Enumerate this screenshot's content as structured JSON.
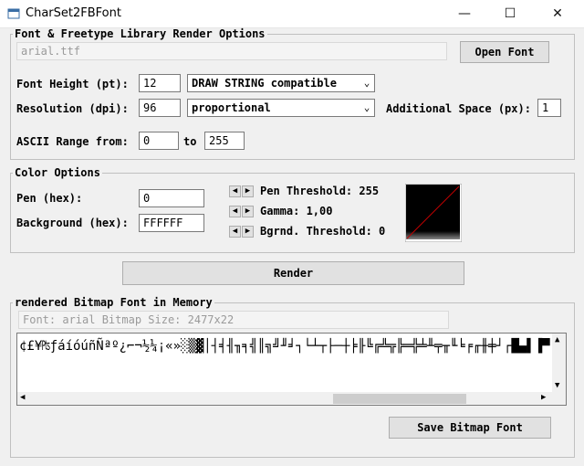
{
  "window": {
    "title": "CharSet2FBFont",
    "minimize_glyph": "—",
    "maximize_glyph": "☐",
    "close_glyph": "✕"
  },
  "render_options": {
    "legend": "Font & Freetype Library Render Options",
    "font_file": "arial.ttf",
    "open_font_label": "Open Font",
    "font_height_label": "Font Height (pt):",
    "font_height_value": "12",
    "height_mode": "DRAW STRING compatible",
    "resolution_label": "Resolution (dpi):",
    "resolution_value": "96",
    "spacing_mode": "proportional",
    "additional_space_label": "Additional Space (px):",
    "additional_space_value": "1",
    "ascii_range_label": "ASCII Range from:",
    "ascii_from": "0",
    "to_label": "to",
    "ascii_to": "255"
  },
  "color_options": {
    "legend": "Color Options",
    "pen_label": "Pen (hex):",
    "pen_value": "0",
    "background_label": "Background (hex):",
    "background_value": "FFFFFF",
    "pen_threshold_label": "Pen Threshold: 255",
    "gamma_label": "Gamma: 1,00",
    "bgrnd_threshold_label": "Bgrnd. Threshold: 0",
    "left_arrow": "◀",
    "right_arrow": "▶"
  },
  "render_label": "Render",
  "bitmap": {
    "legend": "rendered Bitmap Font in Memory",
    "info": "Font: arial  Bitmap Size: 2477x22",
    "glyphs": "¢£¥₧ƒáíóúñÑªº¿⌐¬½¼¡«»░▒▓│┤╡╢╖╕╣║╗╝╜╛┐└┴┬├─┼╞╟╚╔╩╦╠═╬╧╨╤╥╙╘╒╓╫╪┘┌█▄▌▐▀",
    "scroll_up": "▲",
    "scroll_down": "▼",
    "scroll_left": "◀",
    "scroll_right": "▶"
  },
  "save_label": "Save Bitmap Font",
  "colors": {
    "accent": "#0078d7",
    "gradient_line": "#c00000",
    "preview_bg": "#000000"
  }
}
